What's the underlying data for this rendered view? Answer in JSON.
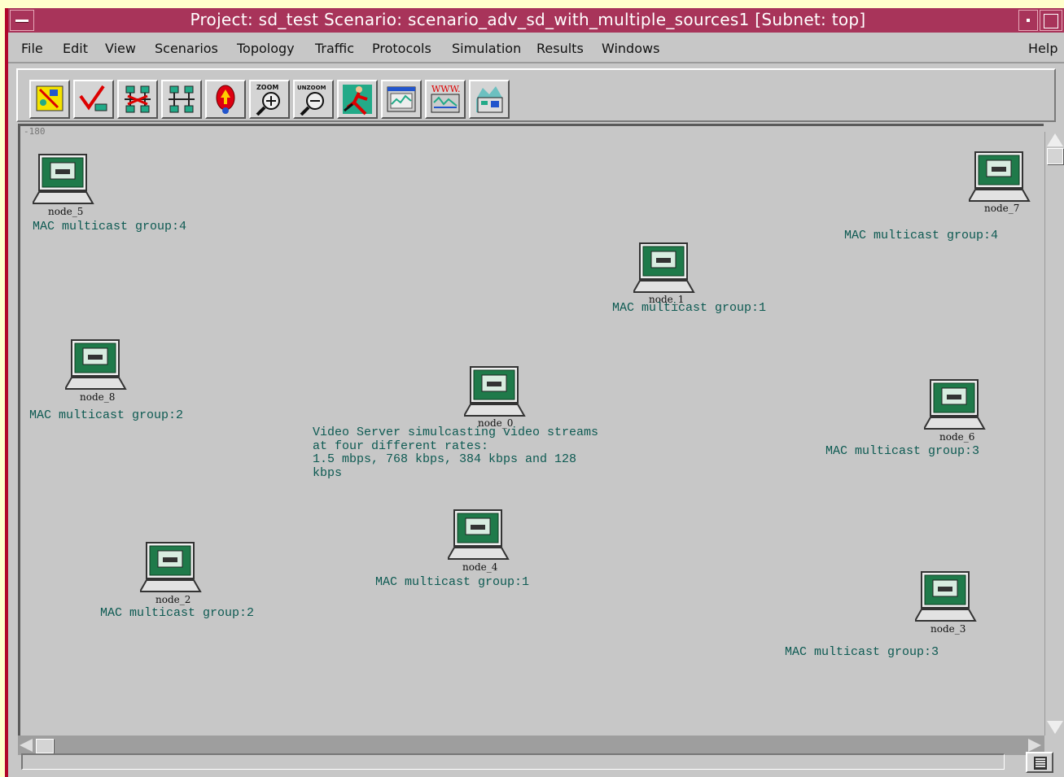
{
  "window": {
    "title": "Project: sd_test Scenario: scenario_adv_sd_with_multiple_sources1  [Subnet: top]"
  },
  "menu": {
    "file": "File",
    "edit": "Edit",
    "view": "View",
    "scenarios": "Scenarios",
    "topology": "Topology",
    "traffic": "Traffic",
    "protocols": "Protocols",
    "simulation": "Simulation",
    "results": "Results",
    "windows": "Windows",
    "help": "Help"
  },
  "toolbar": {
    "buttons": [
      {
        "icon": "object-palette-icon"
      },
      {
        "icon": "check-links-icon"
      },
      {
        "icon": "fail-links-icon"
      },
      {
        "icon": "recover-links-icon"
      },
      {
        "icon": "return-to-parent-icon"
      },
      {
        "icon": "zoom-icon",
        "label": "ZOOM"
      },
      {
        "icon": "unzoom-icon",
        "label": "UNZOOM"
      },
      {
        "icon": "run-simulation-icon"
      },
      {
        "icon": "view-results-icon"
      },
      {
        "icon": "web-report-icon",
        "label": "WWW."
      },
      {
        "icon": "animation-icon"
      }
    ]
  },
  "workspace": {
    "coordinate": "-180",
    "nodes": [
      {
        "name": "node_5",
        "group": "MAC multicast group:4"
      },
      {
        "name": "node_7",
        "group": "MAC multicast group:4"
      },
      {
        "name": "node_1",
        "group": "MAC multicast group:1"
      },
      {
        "name": "node_8",
        "group": "MAC multicast group:2"
      },
      {
        "name": "node_0",
        "note": "Video Server simulcasting video streams\nat four different rates:\n1.5 mbps, 768 kbps, 384 kbps and 128\nkbps"
      },
      {
        "name": "node_6",
        "group": "MAC multicast group:3"
      },
      {
        "name": "node_4",
        "group": "MAC multicast group:1"
      },
      {
        "name": "node_2",
        "group": "MAC multicast group:2"
      },
      {
        "name": "node_3",
        "group": "MAC multicast group:3"
      }
    ]
  },
  "status": {
    "text": ""
  }
}
